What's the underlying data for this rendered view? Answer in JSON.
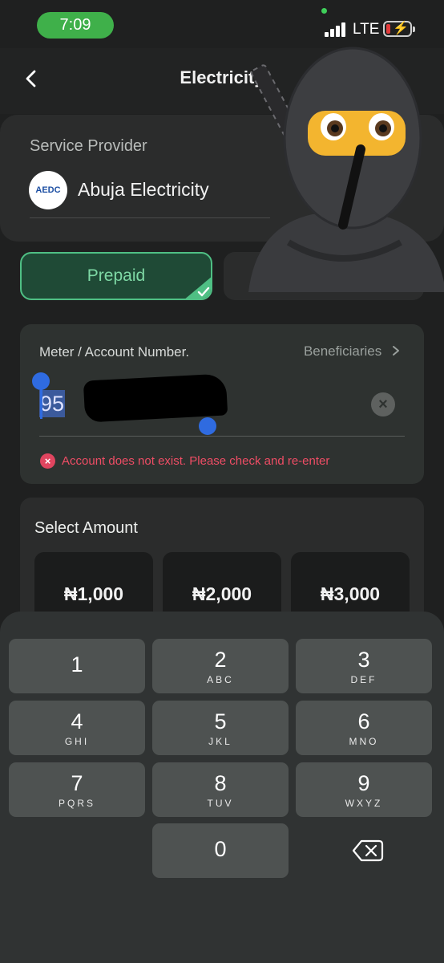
{
  "status_bar": {
    "time": "7:09",
    "network": "LTE"
  },
  "header": {
    "title": "Electricity"
  },
  "provider": {
    "label": "Service Provider",
    "logo_text": "AEDC",
    "name": "Abuja Electricity"
  },
  "tabs": [
    {
      "label": "Prepaid",
      "selected": true
    }
  ],
  "meter": {
    "label": "Meter / Account Number.",
    "beneficiaries_label": "Beneficiaries",
    "value_visible": "95",
    "error": "Account does not exist. Please check and re-enter"
  },
  "amount": {
    "title": "Select Amount",
    "options": [
      "₦1,000",
      "₦2,000",
      "₦3,000"
    ]
  },
  "keypad": {
    "keys": [
      {
        "digit": "1",
        "letters": ""
      },
      {
        "digit": "2",
        "letters": "ABC"
      },
      {
        "digit": "3",
        "letters": "DEF"
      },
      {
        "digit": "4",
        "letters": "GHI"
      },
      {
        "digit": "5",
        "letters": "JKL"
      },
      {
        "digit": "6",
        "letters": "MNO"
      },
      {
        "digit": "7",
        "letters": "PQRS"
      },
      {
        "digit": "8",
        "letters": "TUV"
      },
      {
        "digit": "9",
        "letters": "WXYZ"
      },
      {
        "digit": "0",
        "letters": ""
      }
    ]
  },
  "colors": {
    "accent_green": "#4fbf84",
    "error_red": "#ef4d65",
    "selection_blue": "#2f6be0"
  },
  "icons": [
    "back-chevron-icon",
    "chevron-right-icon",
    "clear-icon",
    "error-icon",
    "checkmark-icon",
    "backspace-icon",
    "ninja-avatar-sticker"
  ]
}
